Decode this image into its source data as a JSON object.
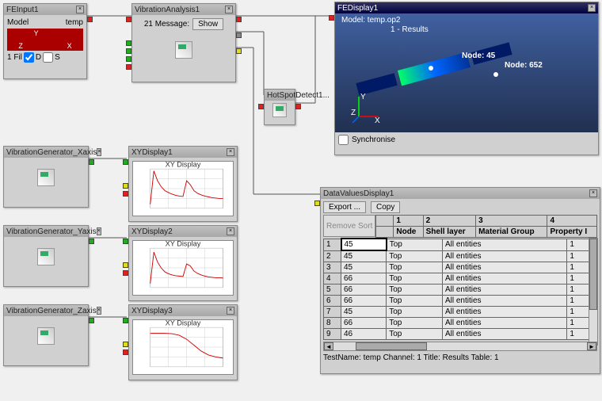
{
  "feinput": {
    "title": "FEInput1",
    "model_label": "Model",
    "temp_label": "temp",
    "axes": [
      "X",
      "Y",
      "Z"
    ],
    "file_label": "1 Fil",
    "checkbox_d": "D",
    "checkbox_s": "S"
  },
  "vibration": {
    "title": "VibrationAnalysis1",
    "message_label": "21 Message:",
    "show_btn": "Show"
  },
  "hotspot": {
    "title": "HotSpotDetect1..."
  },
  "fedisplay": {
    "title": "FEDisplay1",
    "model_line": "Model:    temp.op2",
    "results_line": "1 - Results",
    "node45": "Node: 45",
    "node652": "Node: 652",
    "sync_label": "Synchronise"
  },
  "xygen": [
    {
      "title": "VibrationGenerator_Xaxis"
    },
    {
      "title": "VibrationGenerator_Yaxis"
    },
    {
      "title": "VibrationGenerator_Zaxis"
    }
  ],
  "xydisplays": [
    {
      "title": "XYDisplay1",
      "x_title": "XY Display"
    },
    {
      "title": "XYDisplay2",
      "x_title": "XY Display"
    },
    {
      "title": "XYDisplay3",
      "x_title": "XY Display"
    }
  ],
  "chart_data": [
    {
      "type": "line",
      "title": "XY Display",
      "x": [
        0,
        5,
        10,
        15,
        20,
        25,
        30,
        35,
        40,
        45,
        50,
        55,
        60,
        65,
        70,
        75,
        80,
        85,
        90,
        95,
        100
      ],
      "values": [
        10,
        95,
        70,
        55,
        45,
        40,
        36,
        33,
        31,
        30,
        70,
        60,
        45,
        38,
        34,
        31,
        29,
        27,
        26,
        25,
        25
      ],
      "xlim": [
        0,
        100
      ],
      "ylim": [
        0,
        100
      ],
      "color": "#d00000"
    },
    {
      "type": "line",
      "title": "XY Display",
      "x": [
        0,
        5,
        10,
        15,
        20,
        25,
        30,
        35,
        40,
        45,
        50,
        55,
        60,
        65,
        70,
        75,
        80,
        85,
        90,
        95,
        100
      ],
      "values": [
        10,
        90,
        65,
        50,
        40,
        35,
        32,
        30,
        29,
        28,
        60,
        55,
        42,
        36,
        32,
        29,
        27,
        26,
        25,
        25,
        24
      ],
      "xlim": [
        0,
        100
      ],
      "ylim": [
        0,
        100
      ],
      "color": "#d00000"
    },
    {
      "type": "line",
      "title": "XY Display",
      "x": [
        0,
        10,
        20,
        30,
        40,
        50,
        60,
        70,
        80,
        90,
        100
      ],
      "values": [
        85,
        85,
        85,
        84,
        80,
        70,
        55,
        40,
        30,
        25,
        22
      ],
      "xlim": [
        0,
        100
      ],
      "ylim": [
        0,
        100
      ],
      "color": "#d00000"
    }
  ],
  "datavalues": {
    "title": "DataValuesDisplay1",
    "export_btn": "Export ...",
    "copy_btn": "Copy",
    "remove_sort": "Remove Sort",
    "headers_top": [
      "1",
      "2",
      "3",
      "4"
    ],
    "headers": [
      "Node",
      "Shell layer",
      "Material Group",
      "Property I"
    ],
    "rows": [
      {
        "n": "1",
        "node": "45",
        "shell": "Top",
        "mat": "All entities",
        "prop": "1"
      },
      {
        "n": "2",
        "node": "45",
        "shell": "Top",
        "mat": "All entities",
        "prop": "1"
      },
      {
        "n": "3",
        "node": "45",
        "shell": "Top",
        "mat": "All entities",
        "prop": "1"
      },
      {
        "n": "4",
        "node": "66",
        "shell": "Top",
        "mat": "All entities",
        "prop": "1"
      },
      {
        "n": "5",
        "node": "66",
        "shell": "Top",
        "mat": "All entities",
        "prop": "1"
      },
      {
        "n": "6",
        "node": "66",
        "shell": "Top",
        "mat": "All entities",
        "prop": "1"
      },
      {
        "n": "7",
        "node": "45",
        "shell": "Top",
        "mat": "All entities",
        "prop": "1"
      },
      {
        "n": "8",
        "node": "66",
        "shell": "Top",
        "mat": "All entities",
        "prop": "1"
      },
      {
        "n": "9",
        "node": "46",
        "shell": "Top",
        "mat": "All entities",
        "prop": "1"
      }
    ],
    "status": "TestName: temp  Channel: 1  Title: Results  Table: 1"
  }
}
